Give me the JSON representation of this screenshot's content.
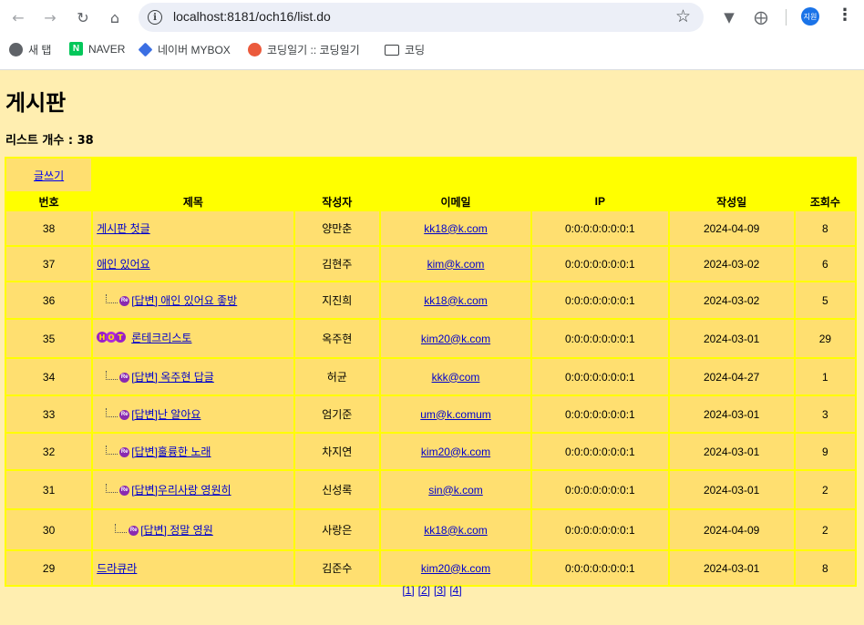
{
  "browser": {
    "url": "localhost:8181/och16/list.do",
    "profile_label": "지원",
    "bookmarks": [
      {
        "label": "새 탭",
        "icon": "globe-icon"
      },
      {
        "label": "NAVER",
        "icon": "naver-icon"
      },
      {
        "label": "네이버 MYBOX",
        "icon": "mybox-icon"
      },
      {
        "label": "코딩일기 :: 코딩일기",
        "icon": "tistory-icon"
      },
      {
        "label": "코딩",
        "icon": "folder-icon"
      }
    ]
  },
  "page": {
    "title": "게시판",
    "count_label": "리스트 개수 : 38",
    "write_label": "글쓰기"
  },
  "table": {
    "headers": [
      "번호",
      "제목",
      "작성자",
      "이메일",
      "IP",
      "작성일",
      "조회수"
    ],
    "rows": [
      {
        "num": "38",
        "subject": "게시판 첫글",
        "reply": false,
        "depth": 0,
        "hot": false,
        "writer": "양만춘",
        "email": "kk18@k.com",
        "ip": "0:0:0:0:0:0:0:1",
        "date": "2024-04-09",
        "hits": "8"
      },
      {
        "num": "37",
        "subject": "애인 있어요",
        "reply": false,
        "depth": 0,
        "hot": false,
        "writer": "김현주",
        "email": "kim@k.com",
        "ip": "0:0:0:0:0:0:0:1",
        "date": "2024-03-02",
        "hits": "6"
      },
      {
        "num": "36",
        "subject": "[답변] 애인 있어요 좋방",
        "reply": true,
        "depth": 1,
        "hot": false,
        "writer": "지진희",
        "email": "kk18@k.com",
        "ip": "0:0:0:0:0:0:0:1",
        "date": "2024-03-02",
        "hits": "5"
      },
      {
        "num": "35",
        "subject": "론테크리스토",
        "reply": false,
        "depth": 0,
        "hot": true,
        "writer": "옥주현",
        "email": "kim20@k.com",
        "ip": "0:0:0:0:0:0:0:1",
        "date": "2024-03-01",
        "hits": "29"
      },
      {
        "num": "34",
        "subject": "[답변] 옥주현 답글",
        "reply": true,
        "depth": 1,
        "hot": false,
        "writer": "허균",
        "email": "kkk@com",
        "ip": "0:0:0:0:0:0:0:1",
        "date": "2024-04-27",
        "hits": "1"
      },
      {
        "num": "33",
        "subject": "[답변]난 알아요",
        "reply": true,
        "depth": 1,
        "hot": false,
        "writer": "엄기준",
        "email": "um@k.comum",
        "ip": "0:0:0:0:0:0:0:1",
        "date": "2024-03-01",
        "hits": "3"
      },
      {
        "num": "32",
        "subject": "[답변]훌륭한 노래",
        "reply": true,
        "depth": 1,
        "hot": false,
        "writer": "차지연",
        "email": "kim20@k.com",
        "ip": "0:0:0:0:0:0:0:1",
        "date": "2024-03-01",
        "hits": "9"
      },
      {
        "num": "31",
        "subject": "[답변]우리사랑 영원히",
        "reply": true,
        "depth": 1,
        "hot": false,
        "writer": "신성록",
        "email": "sin@k.com",
        "ip": "0:0:0:0:0:0:0:1",
        "date": "2024-03-01",
        "hits": "2"
      },
      {
        "num": "30",
        "subject": "[답변] 정말 영원",
        "reply": true,
        "depth": 2,
        "hot": false,
        "writer": "사랑은",
        "email": "kk18@k.com",
        "ip": "0:0:0:0:0:0:0:1",
        "date": "2024-04-09",
        "hits": "2"
      },
      {
        "num": "29",
        "subject": "드라큐라",
        "reply": false,
        "depth": 0,
        "hot": false,
        "writer": "김준수",
        "email": "kim20@k.com",
        "ip": "0:0:0:0:0:0:0:1",
        "date": "2024-03-01",
        "hits": "8"
      }
    ]
  },
  "pager": [
    "[1]",
    "[2]",
    "[3]",
    "[4]"
  ],
  "colors": {
    "page_bg": "#ffeeb0",
    "table_border": "#ffff00",
    "cell_bg": "#ffdf70",
    "link": "#0000cc"
  }
}
